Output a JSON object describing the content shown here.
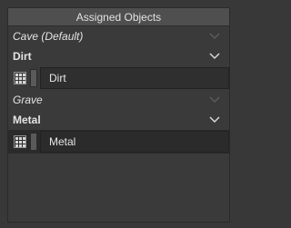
{
  "panel": {
    "title": "Assigned Objects"
  },
  "groups": [
    {
      "group_label": "Cave (Default)",
      "sub_label": "Dirt",
      "item_value": "Dirt"
    },
    {
      "group_label": "Grave",
      "sub_label": "Metal",
      "item_value": "Metal"
    }
  ],
  "colors": {
    "background": "#383838",
    "header": "#4f4f4f",
    "field": "#2f2f2f",
    "text": "#e4e4e4"
  },
  "icons": [
    "chevron-down-icon",
    "grid-icon"
  ]
}
